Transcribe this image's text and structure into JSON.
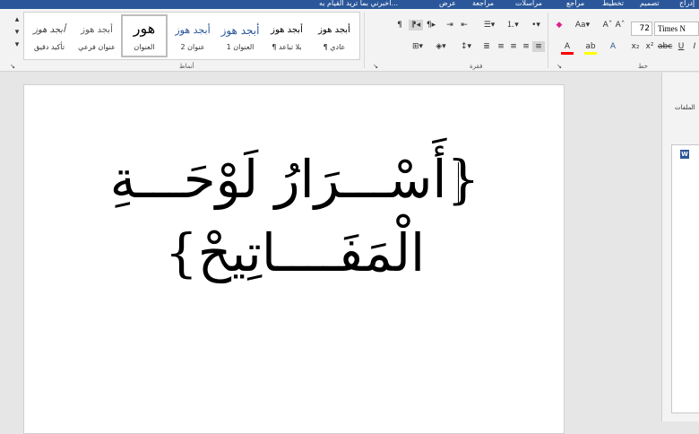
{
  "titlebar": {
    "search_hint": "أخبرني بما تريد القيام به...",
    "tabs": [
      "عرض",
      "مراجعة",
      "مراسلات",
      "مراجع",
      "تخطيط",
      "تصميم",
      "إدراج"
    ]
  },
  "ribbon": {
    "groups": {
      "styles": "أنماط",
      "paragraph": "فقرة",
      "font": "خط"
    },
    "font_name": "Times N",
    "font_size": "72",
    "styles": [
      {
        "sample": "أبجد هوز",
        "name": "¶ عادي"
      },
      {
        "sample": "أبجد هوز",
        "name": "¶ بلا تباعد"
      },
      {
        "sample": "أبجد هوز",
        "name": "العنوان 1"
      },
      {
        "sample": "أبجد هوز",
        "name": "عنوان 2"
      },
      {
        "sample": "هور",
        "name": "العنوان"
      },
      {
        "sample": "أبجد هوز",
        "name": "عنوان فرعي"
      },
      {
        "sample": "أبجد هوز",
        "name": "تأكيد دقيق"
      }
    ],
    "icons": {
      "clear_formatting": "clear-format-icon",
      "font_color": "font-color-icon",
      "highlight": "highlight-icon",
      "align_right": "align-right-icon"
    },
    "colors": {
      "accent": "#2b579a",
      "font_color_bar": "#ff0000",
      "highlight_bar": "#ffff00"
    }
  },
  "document": {
    "line1": "{أَسْـــرَارُ لَوْحَـــةِ",
    "line2": "الْمَفَــــاتِيحْ}"
  },
  "pane": {
    "title": "الملفات",
    "badge": "W"
  }
}
